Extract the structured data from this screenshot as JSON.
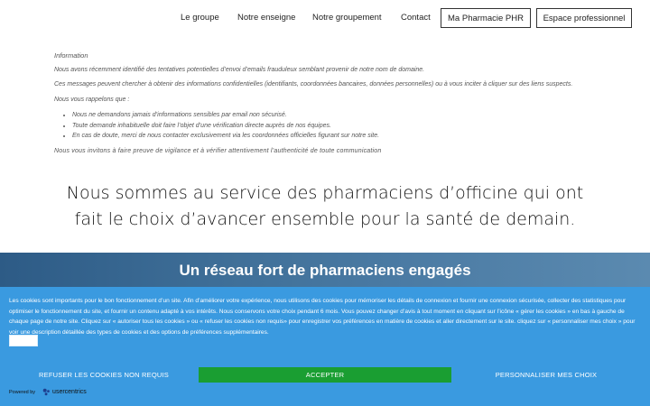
{
  "nav": {
    "links": [
      "Le groupe",
      "Notre enseigne",
      "Notre groupement",
      "Contact"
    ],
    "btn_pharmacie": "Ma Pharmacie PHR",
    "btn_pro": "Espace professionnel"
  },
  "info": {
    "title": "Information",
    "line1": "Nous avons récemment identifié des tentatives potentielles d’envoi d’emails frauduleux semblant provenir de notre nom de domaine.",
    "line2": "Ces messages peuvent chercher à obtenir des informations confidentielles (identifiants, coordonnées bancaires, données personnelles) ou à vous inciter à cliquer sur des liens suspects.",
    "line3": "Nous vous rappelons que :",
    "bullets": [
      "Nous ne demandons jamais d’informations sensibles par email non sécurisé.",
      "Toute demande inhabituelle doit faire l’objet d’une vérification directe auprès de nos équipes.",
      "En cas de doute, merci de nous contacter exclusivement via les coordonnées officielles figurant sur notre site."
    ],
    "closing": "Nous vous invitons à faire preuve de vigilance et à vérifier attentivement l’authenticité de toute communication"
  },
  "headline": {
    "line1": "Nous sommes au service des pharmaciens d’officine qui ont",
    "line2": "fait le choix d’avancer ensemble pour la santé de demain."
  },
  "banner": {
    "title": "Un réseau fort de pharmaciens engagés"
  },
  "cookie": {
    "text": "Les cookies sont importants pour le bon fonctionnement d’un site. Afin d’améliorer votre expérience, nous utilisons des cookies pour mémoriser les détails de connexion et fournir une connexion sécurisée, collecter des statistiques pour optimiser le fonctionnement du site, et fournir un contenu adapté à vos intérêts. Nous conservons votre choix pendant 6 mois. Vous pouvez changer d’avis à tout moment en cliquant sur l’icône « gérer les cookies » en bas à gauche de chaque page de notre site. Cliquez sur « autoriser tous les cookies » ou « refuser les cookies non requis» pour enregistrer vos préférences en matière de cookies et aller directement sur le site. cliquez sur « personnaliser mes choix » pour voir une description détaillée des types de cookies et des options de préférences supplémentaires.",
    "refuse": "REFUSER LES COOKIES NON REQUIS",
    "accept": "ACCEPTER",
    "customize": "PERSONNALISER MES CHOIX",
    "powered_by": "Powered by",
    "brand": "usercentrics"
  },
  "colors": {
    "cookie_bg": "#3a9ae0",
    "accept_bg": "#1a9e32",
    "banner_bg": "#3f6f98"
  }
}
